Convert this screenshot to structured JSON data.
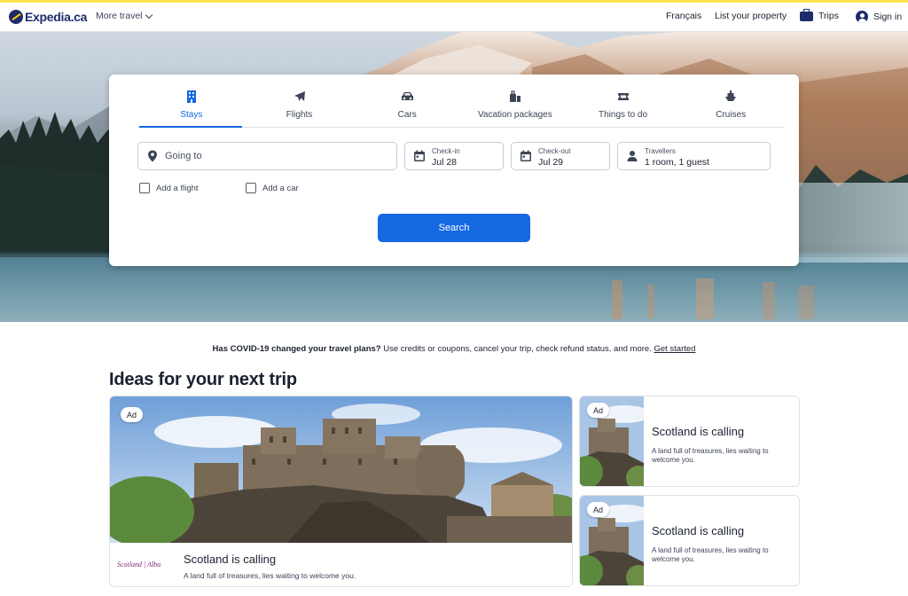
{
  "header": {
    "logo_text": "Expedia.ca",
    "more_travel": "More travel",
    "links": {
      "francais": "Français",
      "list_property": "List your property",
      "trips": "Trips",
      "sign_in": "Sign in"
    }
  },
  "search": {
    "tabs": [
      {
        "label": "Stays",
        "icon": "building-icon",
        "active": true
      },
      {
        "label": "Flights",
        "icon": "plane-icon",
        "active": false
      },
      {
        "label": "Cars",
        "icon": "car-icon",
        "active": false
      },
      {
        "label": "Vacation packages",
        "icon": "package-icon",
        "active": false
      },
      {
        "label": "Things to do",
        "icon": "ticket-icon",
        "active": false
      },
      {
        "label": "Cruises",
        "icon": "ship-icon",
        "active": false
      }
    ],
    "going_to_placeholder": "Going to",
    "check_in_label": "Check-in",
    "check_in_value": "Jul 28",
    "check_out_label": "Check-out",
    "check_out_value": "Jul 29",
    "travellers_label": "Travellers",
    "travellers_value": "1 room, 1 guest",
    "add_flight": "Add a flight",
    "add_car": "Add a car",
    "search_button": "Search",
    "accent_color": "#1668e3"
  },
  "covid": {
    "bold": "Has COVID-19 changed your travel plans?",
    "text": " Use credits or coupons, cancel your trip, check refund status, and more. ",
    "link": "Get started"
  },
  "ideas": {
    "title": "Ideas for your next trip",
    "ad_label": "Ad",
    "big_card": {
      "brand": "Scotland | Alba",
      "title": "Scotland is calling",
      "subtitle": "A land full of treasures, lies waiting to welcome you."
    },
    "small_cards": [
      {
        "title": "Scotland is calling",
        "subtitle": "A land full of treasures, lies waiting to welcome you."
      },
      {
        "title": "Scotland is calling",
        "subtitle": "A land full of treasures, lies waiting to welcome you."
      }
    ]
  }
}
